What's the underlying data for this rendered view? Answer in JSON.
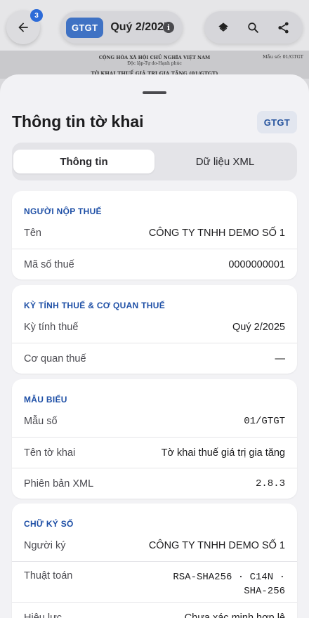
{
  "topbar": {
    "badge_count": "3",
    "tag": "GTGT",
    "title": "Quý 2/2025",
    "info_icon": "info-icon"
  },
  "doc_preview": {
    "line1": "CỘNG HÒA XÃ HỘI CHỦ NGHĨA VIỆT NAM",
    "line2": "Độc lập-Tự do-Hạnh phúc",
    "form_no": "Mẫu số: 01/GTGT",
    "line3": "TỜ KHAI THUẾ GIÁ TRỊ GIA TĂNG (01/GTGT)"
  },
  "sheet": {
    "title": "Thông tin tờ khai",
    "tag": "GTGT",
    "tabs": [
      {
        "label": "Thông tin",
        "active": true
      },
      {
        "label": "Dữ liệu XML",
        "active": false
      }
    ]
  },
  "sections": {
    "taxpayer": {
      "heading": "NGƯỜI NỘP THUẾ",
      "rows": [
        {
          "label": "Tên",
          "value": "CÔNG TY TNHH DEMO SỐ 1"
        },
        {
          "label": "Mã số thuế",
          "value": "0000000001"
        }
      ]
    },
    "period": {
      "heading": "KỲ TÍNH THUẾ & CƠ QUAN THUẾ",
      "rows": [
        {
          "label": "Kỳ tính thuế",
          "value": "Quý 2/2025"
        },
        {
          "label": "Cơ quan thuế",
          "value": "—"
        }
      ]
    },
    "template": {
      "heading": "MẪU BIỂU",
      "rows": [
        {
          "label": "Mẫu số",
          "value": "01/GTGT"
        },
        {
          "label": "Tên tờ khai",
          "value": "Tờ khai thuế giá trị gia tăng"
        },
        {
          "label": "Phiên bản XML",
          "value": "2.8.3"
        }
      ]
    },
    "signature": {
      "heading": "CHỮ KÝ SỐ",
      "rows": [
        {
          "label": "Người ký",
          "value": "CÔNG TY TNHH DEMO SỐ 1"
        },
        {
          "label": "Thuật toán",
          "value_line1": "RSA-SHA256 · C14N ·",
          "value_line2": "SHA-256"
        },
        {
          "label": "Hiệu lực",
          "value": "Chưa xác minh hợp lệ"
        }
      ]
    }
  },
  "colors": {
    "accent": "#1e4fa6",
    "badge": "#2c6bd8",
    "tag_bg": "#3f72c4"
  }
}
